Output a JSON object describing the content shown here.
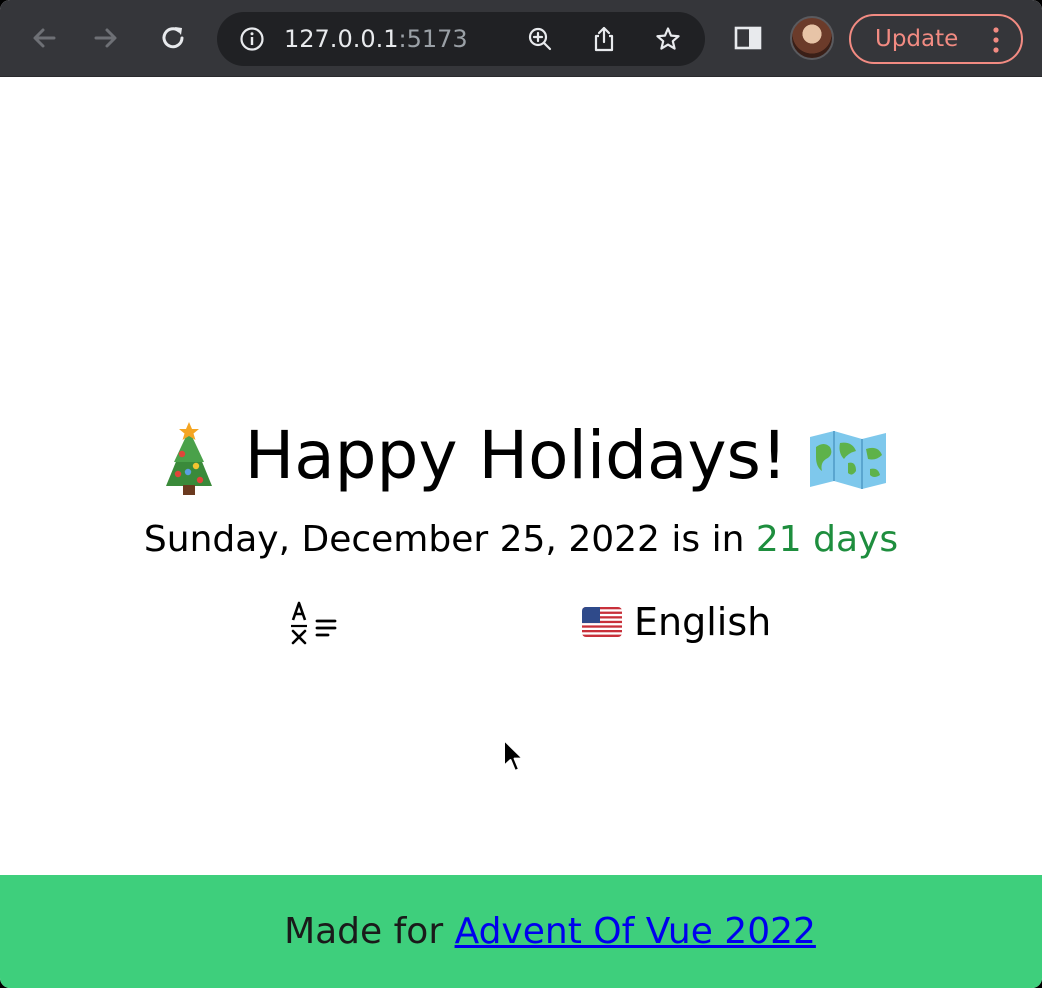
{
  "browser": {
    "url_host": "127.0.0.1",
    "url_port": ":5173",
    "update_label": "Update"
  },
  "page": {
    "headline": "Happy Holidays!",
    "date_text": "Sunday, December 25, 2022 is in ",
    "countdown_text": "21 days",
    "language_label": "English",
    "language_flag": "us-flag-icon",
    "footer_prefix": "Made for ",
    "footer_link": "Advent Of Vue 2022"
  },
  "colors": {
    "toolbar_bg": "#35363a",
    "omnibox_bg": "#202124",
    "update_accent": "#f28b82",
    "countdown_green": "#1e8e3e",
    "footer_bg": "#3ecf7c",
    "link_blue": "#0000ee"
  }
}
